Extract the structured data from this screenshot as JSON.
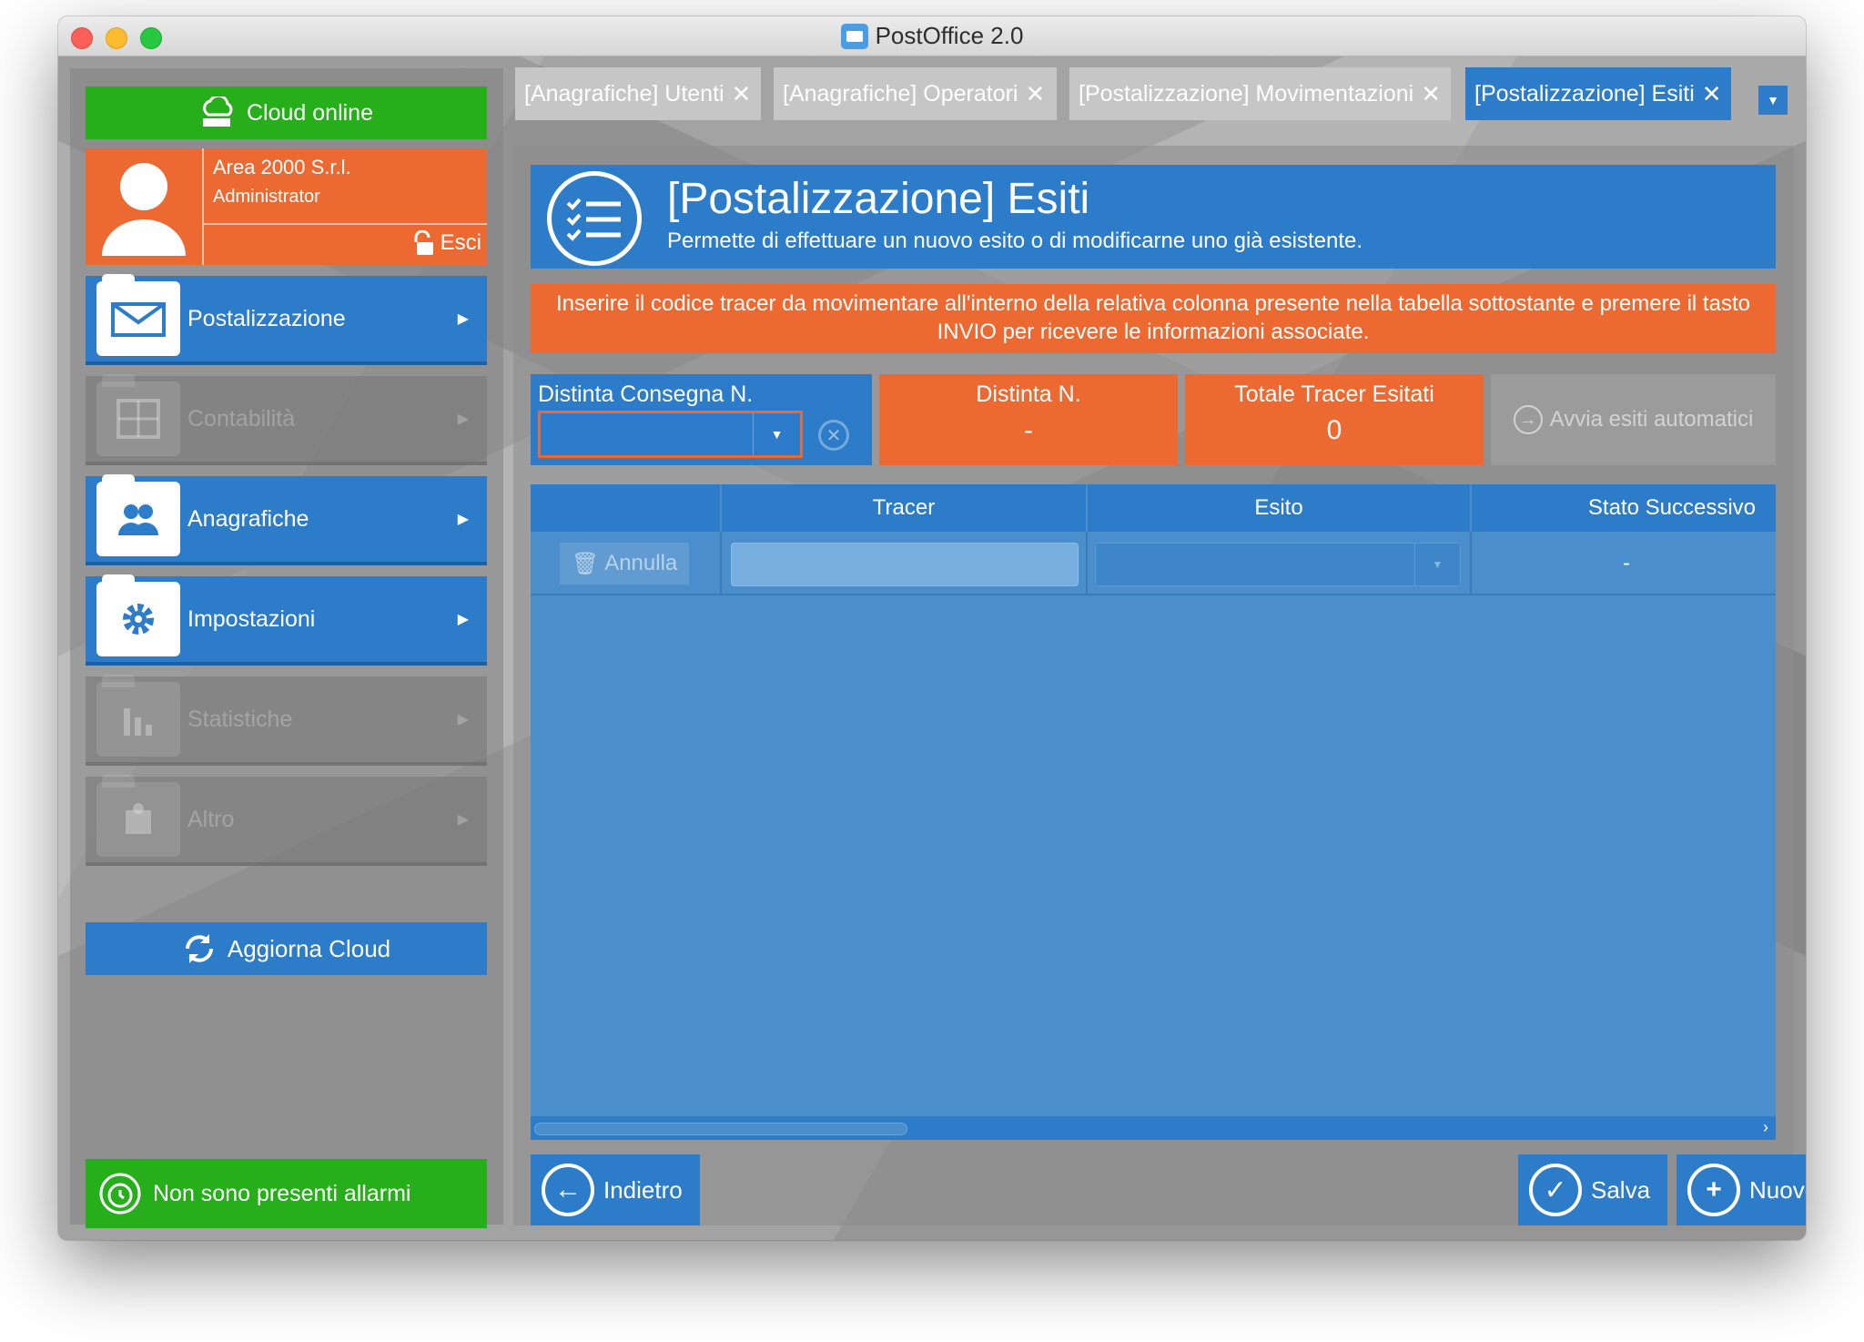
{
  "window": {
    "title": "PostOffice 2.0"
  },
  "sidebar": {
    "cloud_status": "Cloud online",
    "user": {
      "company": "Area 2000 S.r.l.",
      "role": "Administrator",
      "logout_label": "Esci"
    },
    "menu": [
      {
        "label": "Postalizzazione",
        "enabled": true
      },
      {
        "label": "Contabilità",
        "enabled": false
      },
      {
        "label": "Anagrafiche",
        "enabled": true
      },
      {
        "label": "Impostazioni",
        "enabled": true
      },
      {
        "label": "Statistiche",
        "enabled": false
      },
      {
        "label": "Altro",
        "enabled": false
      }
    ],
    "refresh_label": "Aggiorna Cloud",
    "alarms_label": "Non sono presenti allarmi"
  },
  "tabs": [
    {
      "label": "[Anagrafiche] Utenti",
      "active": false
    },
    {
      "label": "[Anagrafiche] Operatori",
      "active": false
    },
    {
      "label": "[Postalizzazione] Movimentazioni",
      "active": false
    },
    {
      "label": "[Postalizzazione] Esiti",
      "active": true
    }
  ],
  "header": {
    "title": "[Postalizzazione] Esiti",
    "subtitle": "Permette di effettuare un nuovo esito o di modificarne uno già esistente."
  },
  "notice": "Inserire il codice tracer da movimentare all'interno della relativa colonna presente nella tabella sottostante e premere il tasto INVIO per ricevere le informazioni associate.",
  "filters": {
    "distinta_consegna_label": "Distinta Consegna N.",
    "distinta_consegna_value": "",
    "distinta_label": "Distinta N.",
    "distinta_value": "-",
    "totale_label": "Totale Tracer Esitati",
    "totale_value": "0",
    "auto_label": "Avvia esiti automatici"
  },
  "table": {
    "columns": [
      "",
      "Tracer",
      "Esito",
      "Stato Successivo"
    ],
    "row": {
      "action_label": "Annulla",
      "tracer": "",
      "esito": "",
      "stato": "-"
    }
  },
  "footer": {
    "back_label": "Indietro",
    "save_label": "Salva",
    "new_label": "Nuovo"
  },
  "colors": {
    "accent_blue": "#2c7cc9",
    "accent_orange": "#ec6a32",
    "status_green": "#27ae1b"
  }
}
